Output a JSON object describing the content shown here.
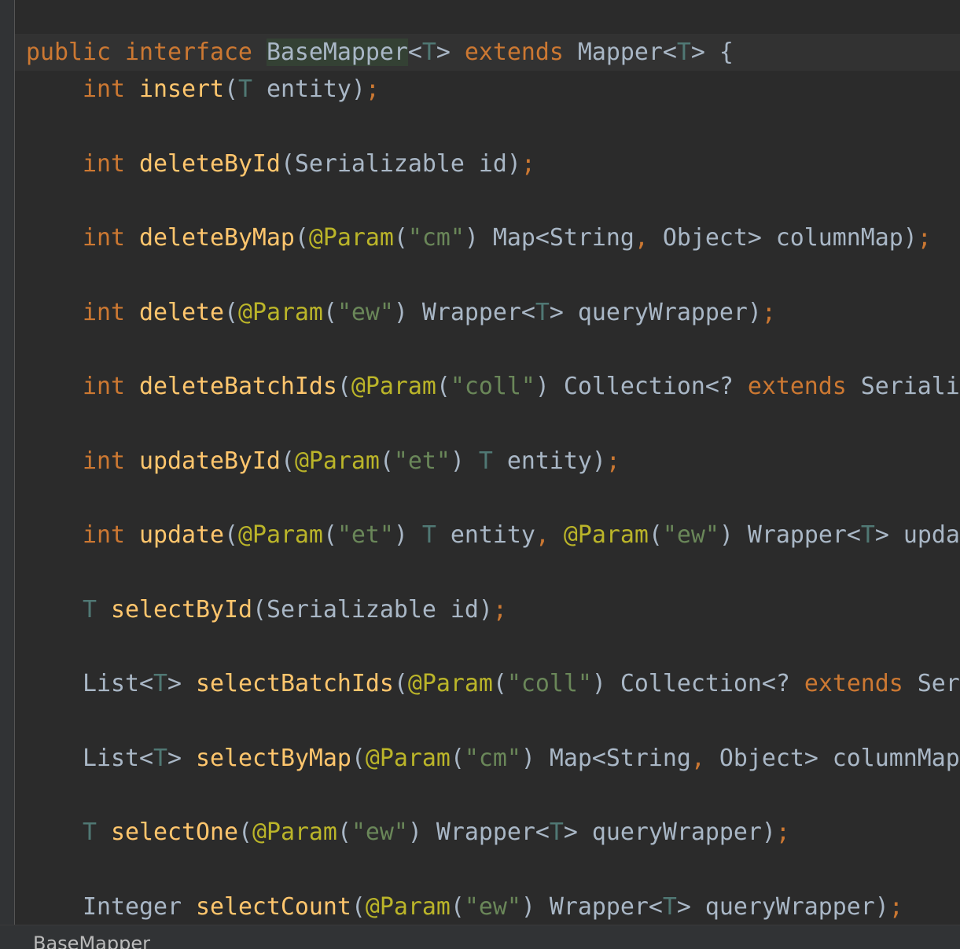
{
  "colors": {
    "background": "#2b2b2b",
    "keyword": "#cc7832",
    "method": "#ffc66d",
    "identifier": "#a9b7c6",
    "type_param": "#507874",
    "annotation": "#bbb529",
    "string": "#6a8759",
    "highlight": "#344134"
  },
  "editor": {
    "lines": [
      [
        [
          "kw",
          "public interface "
        ],
        [
          "hl",
          "BaseMapper"
        ],
        [
          "pu",
          "<"
        ],
        [
          "tp",
          "T"
        ],
        [
          "pu",
          "> "
        ],
        [
          "kw",
          "extends "
        ],
        [
          "ty",
          "Mapper"
        ],
        [
          "pu",
          "<"
        ],
        [
          "tp",
          "T"
        ],
        [
          "pu",
          "> {"
        ]
      ],
      [
        [
          "kw",
          "    int "
        ],
        [
          "fn",
          "insert"
        ],
        [
          "pu",
          "("
        ],
        [
          "tp",
          "T"
        ],
        [
          "ty",
          " entity)"
        ],
        [
          "sc",
          ";"
        ]
      ],
      [],
      [
        [
          "kw",
          "    int "
        ],
        [
          "fn",
          "deleteById"
        ],
        [
          "pu",
          "(Serializable id)"
        ],
        [
          "sc",
          ";"
        ]
      ],
      [],
      [
        [
          "kw",
          "    int "
        ],
        [
          "fn",
          "deleteByMap"
        ],
        [
          "pu",
          "("
        ],
        [
          "an",
          "@Param"
        ],
        [
          "pu",
          "("
        ],
        [
          "st",
          "\"cm\""
        ],
        [
          "pu",
          ") Map<String"
        ],
        [
          "sc",
          ", "
        ],
        [
          "pu",
          "Object> columnMap)"
        ],
        [
          "sc",
          ";"
        ]
      ],
      [],
      [
        [
          "kw",
          "    int "
        ],
        [
          "fn",
          "delete"
        ],
        [
          "pu",
          "("
        ],
        [
          "an",
          "@Param"
        ],
        [
          "pu",
          "("
        ],
        [
          "st",
          "\"ew\""
        ],
        [
          "pu",
          ") Wrapper<"
        ],
        [
          "tp",
          "T"
        ],
        [
          "pu",
          "> queryWrapper)"
        ],
        [
          "sc",
          ";"
        ]
      ],
      [],
      [
        [
          "kw",
          "    int "
        ],
        [
          "fn",
          "deleteBatchIds"
        ],
        [
          "pu",
          "("
        ],
        [
          "an",
          "@Param"
        ],
        [
          "pu",
          "("
        ],
        [
          "st",
          "\"coll\""
        ],
        [
          "pu",
          ") Collection<? "
        ],
        [
          "kw",
          "extends "
        ],
        [
          "pu",
          "Serializable> idList)"
        ],
        [
          "sc",
          ";"
        ]
      ],
      [],
      [
        [
          "kw",
          "    int "
        ],
        [
          "fn",
          "updateById"
        ],
        [
          "pu",
          "("
        ],
        [
          "an",
          "@Param"
        ],
        [
          "pu",
          "("
        ],
        [
          "st",
          "\"et\""
        ],
        [
          "pu",
          ") "
        ],
        [
          "tp",
          "T"
        ],
        [
          "pu",
          " entity)"
        ],
        [
          "sc",
          ";"
        ]
      ],
      [],
      [
        [
          "kw",
          "    int "
        ],
        [
          "fn",
          "update"
        ],
        [
          "pu",
          "("
        ],
        [
          "an",
          "@Param"
        ],
        [
          "pu",
          "("
        ],
        [
          "st",
          "\"et\""
        ],
        [
          "pu",
          ") "
        ],
        [
          "tp",
          "T"
        ],
        [
          "pu",
          " entity"
        ],
        [
          "sc",
          ", "
        ],
        [
          "an",
          "@Param"
        ],
        [
          "pu",
          "("
        ],
        [
          "st",
          "\"ew\""
        ],
        [
          "pu",
          ") Wrapper<"
        ],
        [
          "tp",
          "T"
        ],
        [
          "pu",
          "> updateWrapper)"
        ],
        [
          "sc",
          ";"
        ]
      ],
      [],
      [
        [
          "tp",
          "    T "
        ],
        [
          "fn",
          "selectById"
        ],
        [
          "pu",
          "(Serializable id)"
        ],
        [
          "sc",
          ";"
        ]
      ],
      [],
      [
        [
          "pu",
          "    List<"
        ],
        [
          "tp",
          "T"
        ],
        [
          "pu",
          "> "
        ],
        [
          "fn",
          "selectBatchIds"
        ],
        [
          "pu",
          "("
        ],
        [
          "an",
          "@Param"
        ],
        [
          "pu",
          "("
        ],
        [
          "st",
          "\"coll\""
        ],
        [
          "pu",
          ") Collection<? "
        ],
        [
          "kw",
          "extends "
        ],
        [
          "pu",
          "Serializable> idList)"
        ],
        [
          "sc",
          ";"
        ]
      ],
      [],
      [
        [
          "pu",
          "    List<"
        ],
        [
          "tp",
          "T"
        ],
        [
          "pu",
          "> "
        ],
        [
          "fn",
          "selectByMap"
        ],
        [
          "pu",
          "("
        ],
        [
          "an",
          "@Param"
        ],
        [
          "pu",
          "("
        ],
        [
          "st",
          "\"cm\""
        ],
        [
          "pu",
          ") Map<String"
        ],
        [
          "sc",
          ", "
        ],
        [
          "pu",
          "Object> columnMap)"
        ],
        [
          "sc",
          ";"
        ]
      ],
      [],
      [
        [
          "tp",
          "    T "
        ],
        [
          "fn",
          "selectOne"
        ],
        [
          "pu",
          "("
        ],
        [
          "an",
          "@Param"
        ],
        [
          "pu",
          "("
        ],
        [
          "st",
          "\"ew\""
        ],
        [
          "pu",
          ") Wrapper<"
        ],
        [
          "tp",
          "T"
        ],
        [
          "pu",
          "> queryWrapper)"
        ],
        [
          "sc",
          ";"
        ]
      ],
      [],
      [
        [
          "pu",
          "    Integer "
        ],
        [
          "fn",
          "selectCount"
        ],
        [
          "pu",
          "("
        ],
        [
          "an",
          "@Param"
        ],
        [
          "pu",
          "("
        ],
        [
          "st",
          "\"ew\""
        ],
        [
          "pu",
          ") Wrapper<"
        ],
        [
          "tp",
          "T"
        ],
        [
          "pu",
          "> queryWrapper)"
        ],
        [
          "sc",
          ";"
        ]
      ]
    ]
  },
  "status": {
    "breadcrumb": "BaseMapper"
  }
}
